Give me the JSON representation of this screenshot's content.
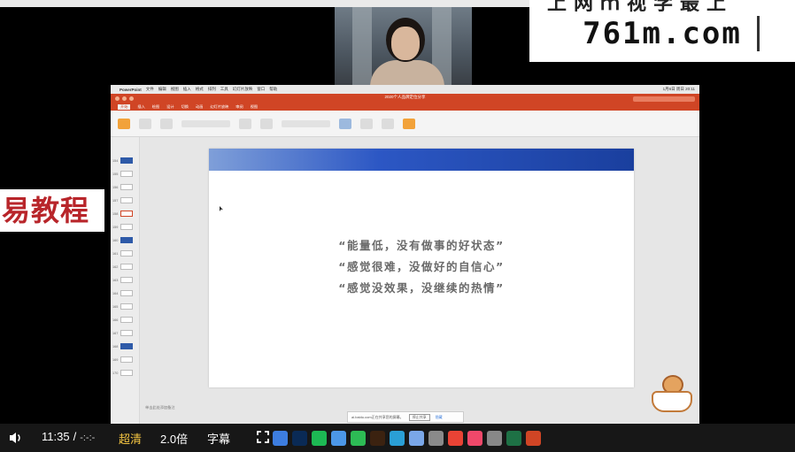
{
  "watermark": {
    "url": "761m.com",
    "top_clip": "上网ｍ视学最上"
  },
  "side_label": "易教程",
  "ppt": {
    "menubar": [
      "PowerPoint",
      "文件",
      "编辑",
      "视图",
      "插入",
      "格式",
      "排列",
      "工具",
      "幻灯片放映",
      "窗口",
      "帮助"
    ],
    "clock": "1月6日 周日 20:11",
    "doc_title": "2020个人品牌定位分享",
    "tabs": [
      "开始",
      "插入",
      "绘图",
      "设计",
      "切换",
      "动画",
      "幻灯片放映",
      "审阅",
      "视图"
    ],
    "slide_quotes": [
      "“能量低，没有做事的好状态”",
      "“感觉很难，没做好的自信心”",
      "“感觉没效果，没继续的热情”"
    ],
    "notes_placeholder": "单击此处添加备注",
    "notification": {
      "text": "ai.baidu.com正在共享您的屏幕。",
      "button": "停止共享",
      "link": "隐藏"
    },
    "thumb_numbers": [
      "154",
      "155",
      "156",
      "157",
      "158",
      "159",
      "160",
      "161",
      "162",
      "163",
      "164",
      "165",
      "166",
      "167",
      "168",
      "169",
      "170"
    ]
  },
  "player": {
    "time_current": "11:35",
    "time_total": "-:-:-",
    "quality": "超清",
    "speed": "2.0倍",
    "subtitle": "字幕"
  },
  "colors": {
    "ppt_accent": "#d04525",
    "slide_bar_start": "#7f9fd9",
    "slide_bar_end": "#1a3f9e",
    "quality_yellow": "#f4c542"
  },
  "dock_icons": [
    "finder-icon",
    "ps-icon",
    "spotify-icon",
    "mail-icon",
    "wechat-icon",
    "ai-icon",
    "qq-icon",
    "launcher-icon",
    "tools-icon",
    "chrome-icon",
    "music-icon",
    "settings-icon",
    "excel-icon",
    "powerpoint-icon"
  ]
}
